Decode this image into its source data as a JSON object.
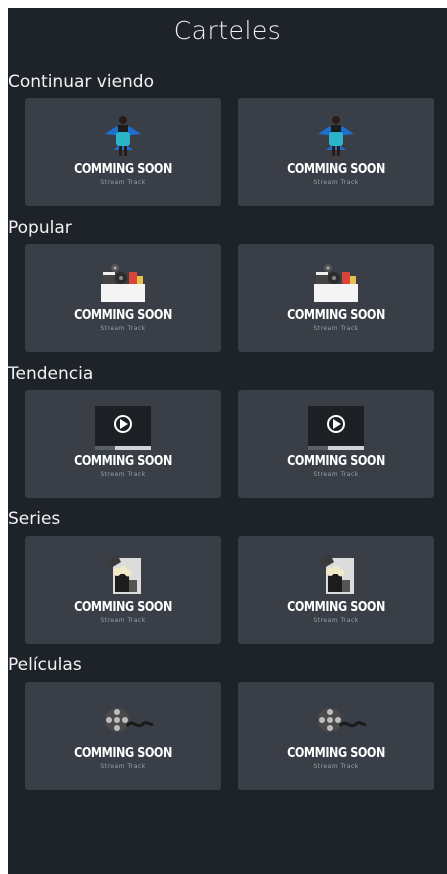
{
  "header": {
    "title": "Carteles"
  },
  "sections": [
    {
      "title": "Continuar viendo",
      "thumb": "woman-portrait-icon",
      "cards": [
        {
          "label": "COMMING SOON",
          "brand": "Stream Track"
        },
        {
          "label": "COMMING SOON",
          "brand": "Stream Track"
        }
      ]
    },
    {
      "title": "Popular",
      "thumb": "cinema-props-icon",
      "cards": [
        {
          "label": "COMMING SOON",
          "brand": "Stream Track"
        },
        {
          "label": "COMMING SOON",
          "brand": "Stream Track"
        }
      ]
    },
    {
      "title": "Tendencia",
      "thumb": "video-player-icon",
      "cards": [
        {
          "label": "COMMING SOON",
          "brand": "Stream Track"
        },
        {
          "label": "COMMING SOON",
          "brand": "Stream Track"
        }
      ]
    },
    {
      "title": "Series",
      "thumb": "popcorn-clapper-icon",
      "cards": [
        {
          "label": "COMMING SOON",
          "brand": "Stream Track"
        },
        {
          "label": "COMMING SOON",
          "brand": "Stream Track"
        }
      ]
    },
    {
      "title": "Películas",
      "thumb": "film-reel-icon",
      "cards": [
        {
          "label": "COMMING SOON",
          "brand": "Stream Track"
        },
        {
          "label": "COMMING SOON",
          "brand": "Stream Track"
        }
      ]
    }
  ],
  "colors": {
    "background": "#1e2329",
    "card": "#3a3f47",
    "text": "#f2f2f2",
    "accent_blue": "#1f6fd1",
    "accent_teal": "#2ab3c9"
  }
}
